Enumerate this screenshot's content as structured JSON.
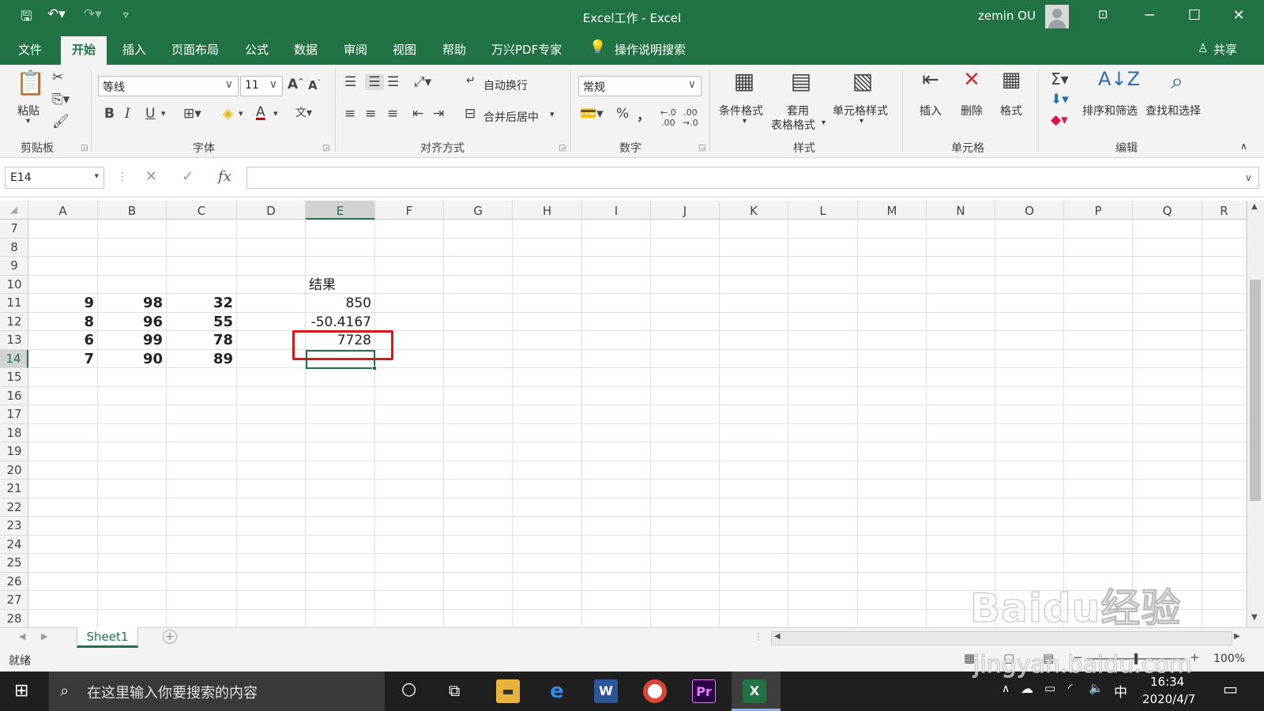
{
  "titlebar": {
    "title": "Excel工作  -  Excel",
    "user": "zemin OU"
  },
  "tabs": [
    "文件",
    "开始",
    "插入",
    "页面布局",
    "公式",
    "数据",
    "审阅",
    "视图",
    "帮助",
    "万兴PDF专家"
  ],
  "tell_me": "操作说明搜索",
  "share": "共享",
  "ribbon": {
    "clipboard": {
      "paste": "粘贴",
      "group": "剪贴板"
    },
    "font": {
      "name": "等线",
      "size": "11",
      "bold": "B",
      "italic": "I",
      "underline": "U",
      "group": "字体"
    },
    "alignment": {
      "wrap": "自动换行",
      "merge": "合并后居中",
      "group": "对齐方式"
    },
    "number": {
      "format": "常规",
      "percent": "%",
      "comma": "，",
      "group": "数字"
    },
    "styles": {
      "conditional": "条件格式",
      "table_l1": "套用",
      "table_l2": "表格格式",
      "cell_styles": "单元格样式",
      "group": "样式"
    },
    "cells": {
      "insert": "插入",
      "delete": "删除",
      "format": "格式",
      "group": "单元格"
    },
    "editing": {
      "sort": "排序和筛选",
      "find": "查找和选择",
      "group": "编辑"
    }
  },
  "formula_bar": {
    "name_box": "E14",
    "fx": "fx",
    "value": ""
  },
  "grid": {
    "columns": [
      "A",
      "B",
      "C",
      "D",
      "E",
      "F",
      "G",
      "H",
      "I",
      "J",
      "K",
      "L",
      "M",
      "N",
      "O",
      "P",
      "Q",
      "R"
    ],
    "selected_column": "E",
    "rows": [
      "7",
      "8",
      "9",
      "10",
      "11",
      "12",
      "13",
      "14",
      "15",
      "16",
      "17",
      "18",
      "19",
      "20",
      "21",
      "22",
      "23",
      "24",
      "25",
      "26",
      "27",
      "28"
    ],
    "selected_row": "14",
    "cells": {
      "E10": "结果",
      "A11": "9",
      "B11": "98",
      "C11": "32",
      "E11": "850",
      "A12": "8",
      "B12": "96",
      "C12": "55",
      "E12": "-50.4167",
      "A13": "6",
      "B13": "99",
      "C13": "78",
      "E13": "7728",
      "A14": "7",
      "B14": "90",
      "C14": "89"
    }
  },
  "sheet_tab": "Sheet1",
  "status": {
    "ready": "就绪",
    "zoom": "100%"
  },
  "taskbar": {
    "search_placeholder": "在这里输入你要搜索的内容",
    "time": "16:34",
    "date": "2020/4/7",
    "ime": "中"
  },
  "watermark": {
    "line1": "Baidu经验",
    "line2": "jingyan.baidu.com"
  },
  "colors": {
    "excel_green": "#217346",
    "highlight_red": "#d9161c"
  }
}
